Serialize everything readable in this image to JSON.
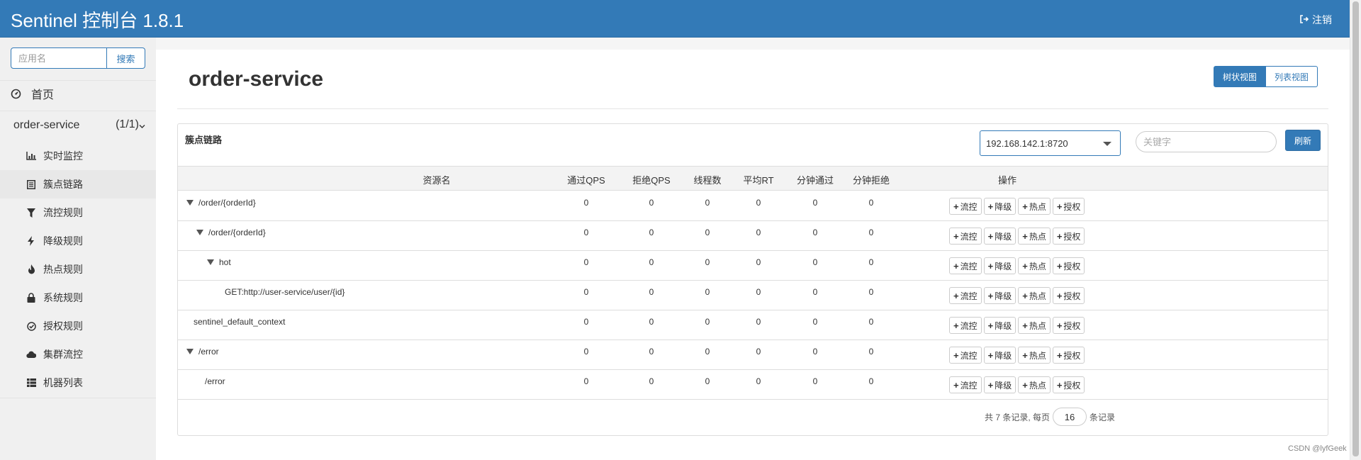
{
  "header": {
    "title": "Sentinel 控制台 1.8.1",
    "logout_label": "注销"
  },
  "sidebar": {
    "search_placeholder": "应用名",
    "search_button": "搜索",
    "home_label": "首页",
    "app": {
      "name": "order-service",
      "count": "(1/1)"
    },
    "items": [
      {
        "label": "实时监控",
        "icon": "bar-chart-icon"
      },
      {
        "label": "簇点链路",
        "icon": "list-icon"
      },
      {
        "label": "流控规则",
        "icon": "filter-icon"
      },
      {
        "label": "降级规则",
        "icon": "flash-icon"
      },
      {
        "label": "热点规则",
        "icon": "fire-icon"
      },
      {
        "label": "系统规则",
        "icon": "lock-icon"
      },
      {
        "label": "授权规则",
        "icon": "check-circle-icon"
      },
      {
        "label": "集群流控",
        "icon": "cloud-icon"
      },
      {
        "label": "机器列表",
        "icon": "th-list-icon"
      }
    ]
  },
  "main": {
    "page_title": "order-service",
    "view_tree": "树状视图",
    "view_list": "列表视图",
    "panel_title": "簇点链路",
    "machine": "192.168.142.1:8720",
    "keyword_placeholder": "关键字",
    "refresh": "刷新"
  },
  "table": {
    "headers": [
      "资源名",
      "通过QPS",
      "拒绝QPS",
      "线程数",
      "平均RT",
      "分钟通过",
      "分钟拒绝",
      "操作"
    ],
    "rows": [
      {
        "name": "/order/{orderId}",
        "level": 0,
        "expand": true,
        "values": [
          "0",
          "0",
          "0",
          "0",
          "0",
          "0"
        ]
      },
      {
        "name": "/order/{orderId}",
        "level": 1,
        "expand": true,
        "values": [
          "0",
          "0",
          "0",
          "0",
          "0",
          "0"
        ]
      },
      {
        "name": "hot",
        "level": 2,
        "expand": true,
        "values": [
          "0",
          "0",
          "0",
          "0",
          "0",
          "0"
        ]
      },
      {
        "name": "GET:http://user-service/user/{id}",
        "level": 3,
        "expand": false,
        "values": [
          "0",
          "0",
          "0",
          "0",
          "0",
          "0"
        ]
      },
      {
        "name": "sentinel_default_context",
        "level": 4,
        "expand": false,
        "values": [
          "0",
          "0",
          "0",
          "0",
          "0",
          "0"
        ]
      },
      {
        "name": "/error",
        "level": 0,
        "expand": true,
        "values": [
          "0",
          "0",
          "0",
          "0",
          "0",
          "0"
        ]
      },
      {
        "name": "/error",
        "level": 5,
        "expand": false,
        "values": [
          "0",
          "0",
          "0",
          "0",
          "0",
          "0"
        ]
      }
    ],
    "ops": [
      "流控",
      "降级",
      "热点",
      "授权"
    ]
  },
  "pager": {
    "prefix": "共 7 条记录, 每页",
    "page_size": "16",
    "suffix": "条记录"
  },
  "watermark": "CSDN @lyfGeek"
}
